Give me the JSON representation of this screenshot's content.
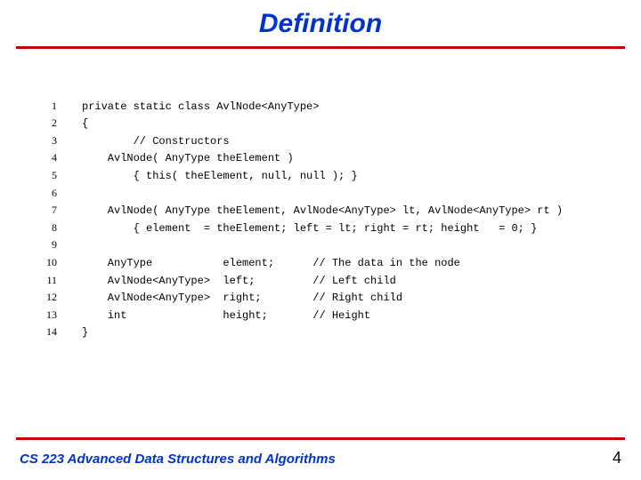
{
  "title": "Definition",
  "footer": {
    "course": "CS 223 Advanced Data Structures and Algorithms",
    "page": "4"
  },
  "code": {
    "lines": [
      {
        "n": "1",
        "t": "private static class AvlNode<AnyType>"
      },
      {
        "n": "2",
        "t": "{"
      },
      {
        "n": "3",
        "t": "        // Constructors"
      },
      {
        "n": "4",
        "t": "    AvlNode( AnyType theElement )"
      },
      {
        "n": "5",
        "t": "        { this( theElement, null, null ); }"
      },
      {
        "n": "6",
        "t": ""
      },
      {
        "n": "7",
        "t": "    AvlNode( AnyType theElement, AvlNode<AnyType> lt, AvlNode<AnyType> rt )"
      },
      {
        "n": "8",
        "t": "        { element  = theElement; left = lt; right = rt; height   = 0; }"
      },
      {
        "n": "9",
        "t": ""
      },
      {
        "n": "10",
        "t": "    AnyType           element;      // The data in the node"
      },
      {
        "n": "11",
        "t": "    AvlNode<AnyType>  left;         // Left child"
      },
      {
        "n": "12",
        "t": "    AvlNode<AnyType>  right;        // Right child"
      },
      {
        "n": "13",
        "t": "    int               height;       // Height"
      },
      {
        "n": "14",
        "t": "}"
      }
    ]
  }
}
